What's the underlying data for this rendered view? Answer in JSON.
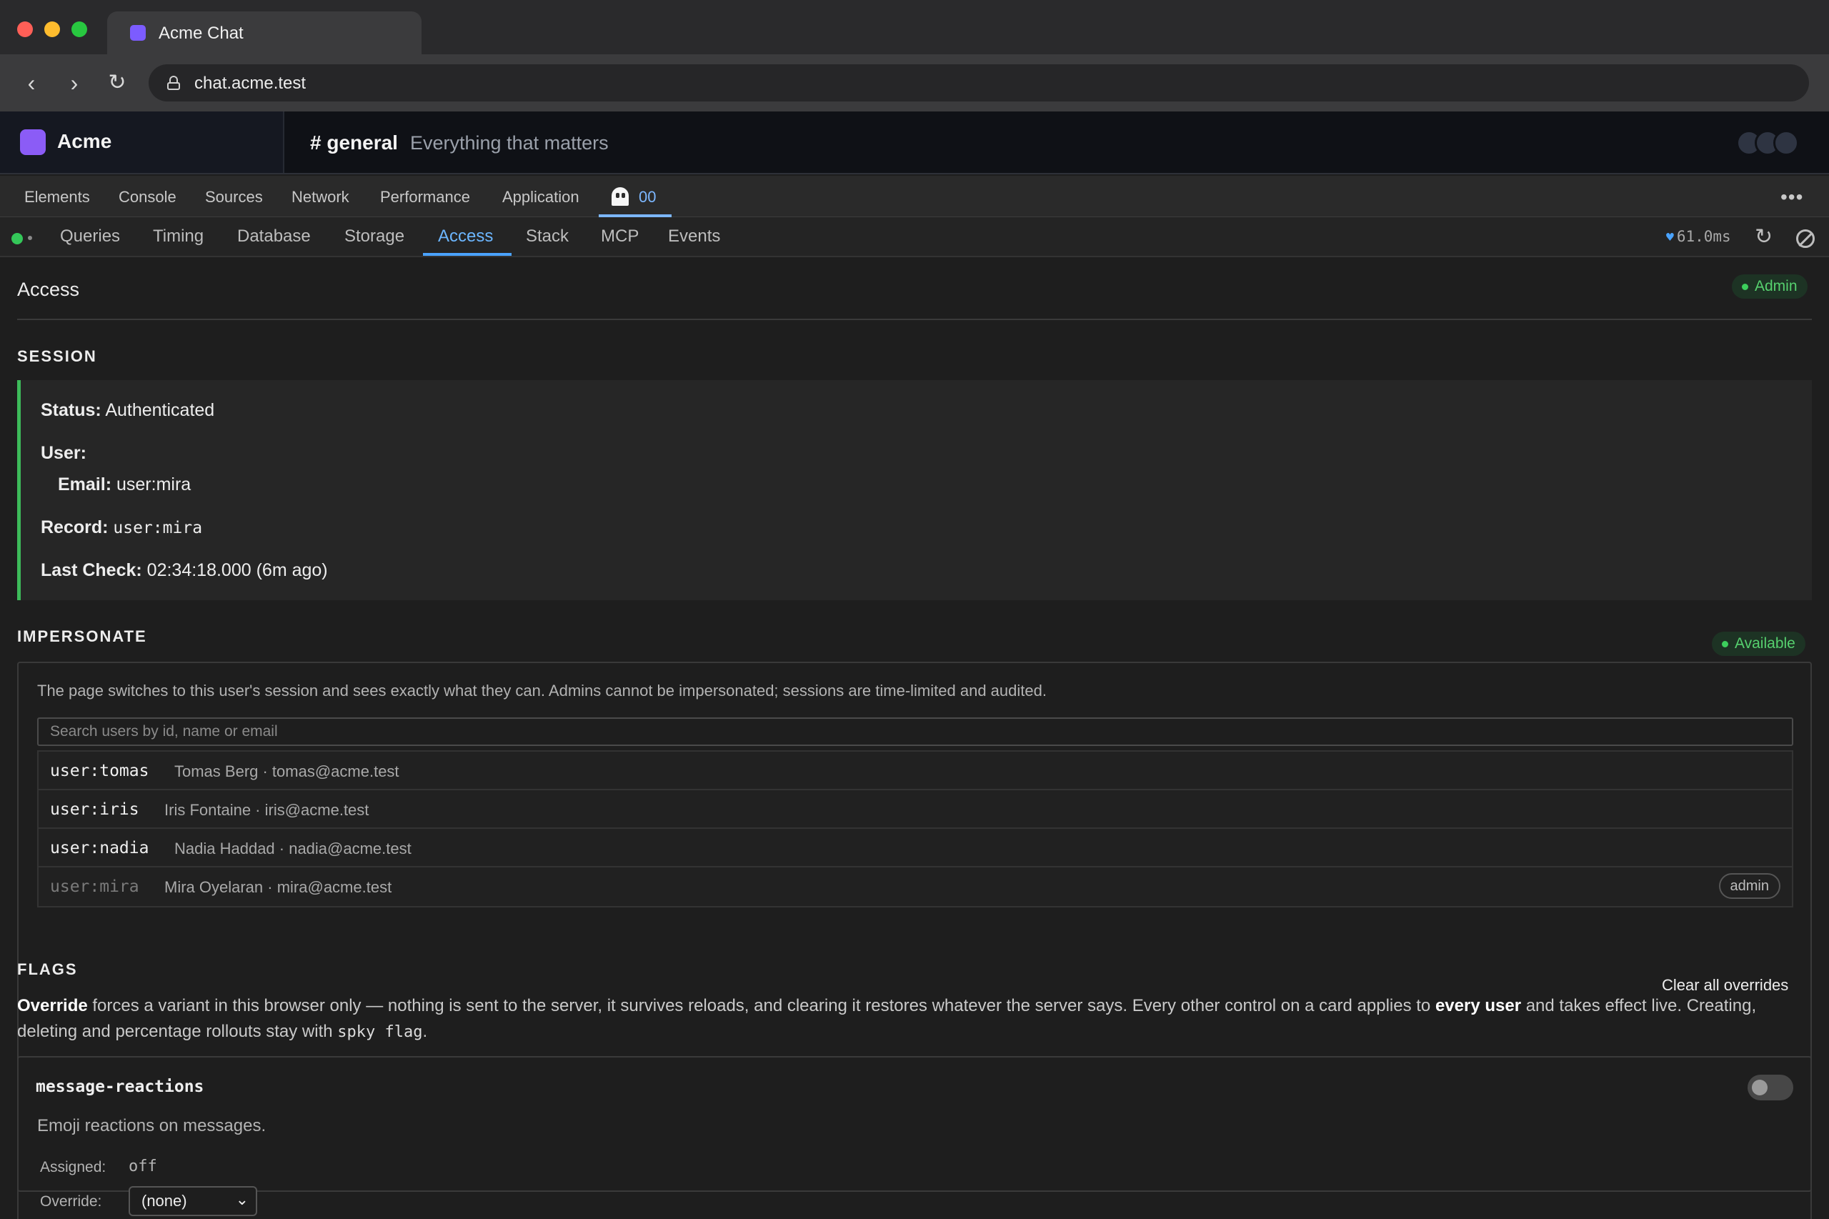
{
  "browser": {
    "tab_title": "Acme Chat",
    "url": "chat.acme.test",
    "icons": {
      "back": "chevron-left-icon",
      "forward": "chevron-right-icon",
      "reload": "reload-icon",
      "lock": "lock-icon"
    }
  },
  "app": {
    "workspace": "Acme",
    "channel": "# general",
    "topic": "Everything that matters",
    "colors": {
      "workspace_logo": "#8b5cf6"
    }
  },
  "devtools": {
    "tabs": [
      "Elements",
      "Console",
      "Sources",
      "Network",
      "Performance",
      "Application"
    ],
    "extension_tab": {
      "label": "00",
      "icon": "ghost-icon"
    },
    "more_icon": "more-icon"
  },
  "panel_nav": {
    "tabs": [
      "Queries",
      "Timing",
      "Database",
      "Storage",
      "Access",
      "Stack",
      "MCP",
      "Events"
    ],
    "active": "Access",
    "latency": "61.0ms",
    "colors": {
      "status_dot": "#34c759",
      "accent": "#4aa3ff"
    }
  },
  "access": {
    "title": "Access",
    "role_badge": "Admin",
    "session": {
      "title": "SESSION",
      "status_label": "Status:",
      "status_value": "Authenticated",
      "user_label": "User:",
      "email_label": "Email:",
      "email_value": "user:mira",
      "record_label": "Record:",
      "record_value": "user:mira",
      "last_check_label": "Last Check:",
      "last_check_value": "02:34:18.000 (6m ago)"
    },
    "impersonate": {
      "title": "IMPERSONATE",
      "badge": "Available",
      "description": "The page switches to this user's session and sees exactly what they can. Admins cannot be impersonated; sessions are time-limited and audited.",
      "search_placeholder": "Search users by id, name or email",
      "users": [
        {
          "id": "user:tomas",
          "meta": "Tomas Berg · tomas@acme.test"
        },
        {
          "id": "user:iris",
          "meta": "Iris Fontaine · iris@acme.test"
        },
        {
          "id": "user:nadia",
          "meta": "Nadia Haddad · nadia@acme.test"
        },
        {
          "id": "user:mira",
          "meta": "Mira Oyelaran · mira@acme.test",
          "badge": "admin"
        }
      ]
    },
    "flags": {
      "title": "FLAGS",
      "clear_label": "Clear all overrides",
      "desc_override": "Override",
      "desc_part1": " forces a variant in this browser only — nothing is sent to the server, it survives reloads, and clearing it restores whatever the server says. Every other control on a card applies to ",
      "desc_every_user": "every user",
      "desc_part2": " and takes effect live. Creating, deleting and percentage rollouts stay with ",
      "desc_code": "spky flag",
      "desc_end": ".",
      "cards": [
        {
          "name": "message-reactions",
          "description": "Emoji reactions on messages.",
          "assigned_label": "Assigned:",
          "assigned_value": "off",
          "override_label": "Override:",
          "override_value": "(none)",
          "enabled": false
        }
      ]
    }
  }
}
